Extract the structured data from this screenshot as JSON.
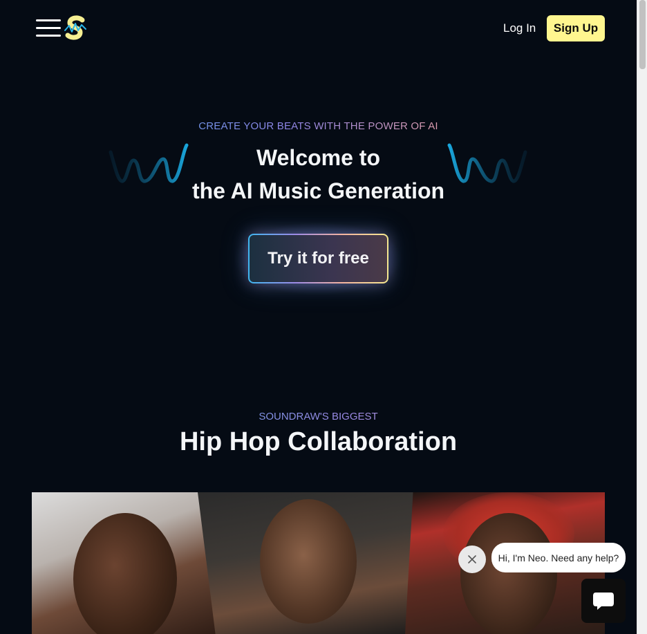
{
  "header": {
    "login_label": "Log In",
    "signup_label": "Sign Up",
    "signup_color": "#fff68f"
  },
  "hero": {
    "tagline": "CREATE YOUR BEATS WITH THE POWER OF AI",
    "title_line1": "Welcome to",
    "title_line2": "the AI Music Generation",
    "cta_label": "Try it for free"
  },
  "section": {
    "kicker": "SOUNDRAW'S BIGGEST",
    "title": "Hip Hop Collaboration"
  },
  "chat": {
    "message": "Hi, I'm Neo. Need any help?"
  },
  "colors": {
    "background": "#050b14",
    "gradient": [
      "#39b4f0",
      "#9b8ae6",
      "#f2a3a0",
      "#f4e38a"
    ]
  }
}
